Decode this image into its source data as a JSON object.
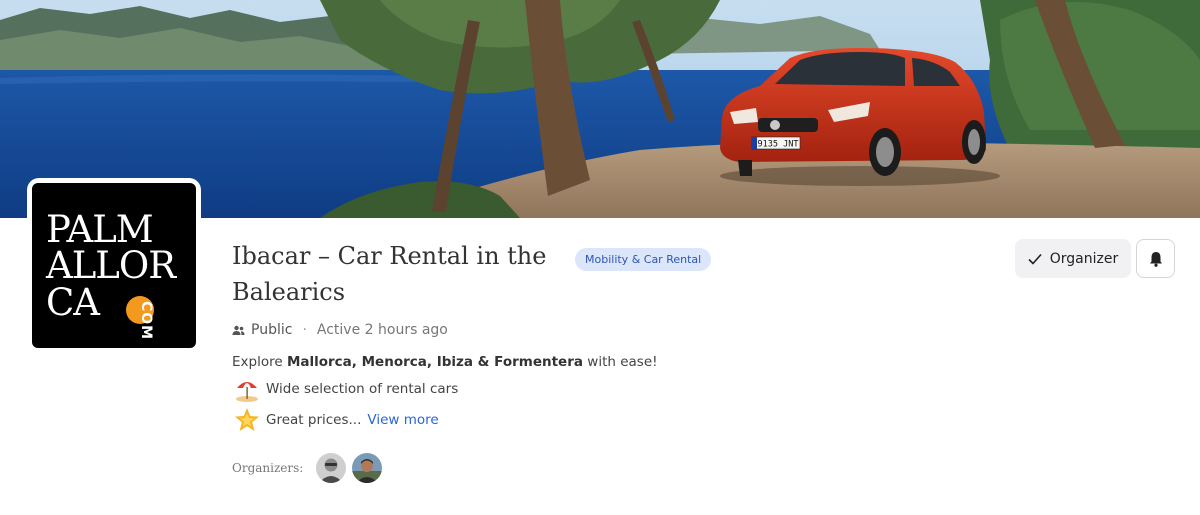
{
  "group": {
    "title": "Ibacar – Car Rental in the Balearics",
    "category_badge": "Mobility & Car Rental",
    "visibility": "Public",
    "separator": "·",
    "activity": "Active 2 hours ago",
    "description_prefix": "Explore ",
    "description_bold": "Mallorca, Menorca, Ibiza & Formentera",
    "description_suffix": " with ease!",
    "features": [
      {
        "icon": "beach-umbrella-icon",
        "text": "Wide selection of rental cars"
      },
      {
        "icon": "star-icon",
        "text": "Great prices..."
      }
    ],
    "view_more": "View more",
    "organizers_label": "Organizers:"
  },
  "logo": {
    "line1": "PALM",
    "line2": "ALLOR",
    "line3": "CA",
    "suffix": "COM",
    "accent_color": "#f39a1e"
  },
  "actions": {
    "organizer_button": "Organizer",
    "organizer_icon": "check-icon",
    "bell_icon": "bell-icon"
  },
  "banner": {
    "plate": "9135 JNT"
  },
  "colors": {
    "badge_bg": "#dbe6fb",
    "badge_text": "#2d55b0",
    "link": "#2a66d8"
  }
}
